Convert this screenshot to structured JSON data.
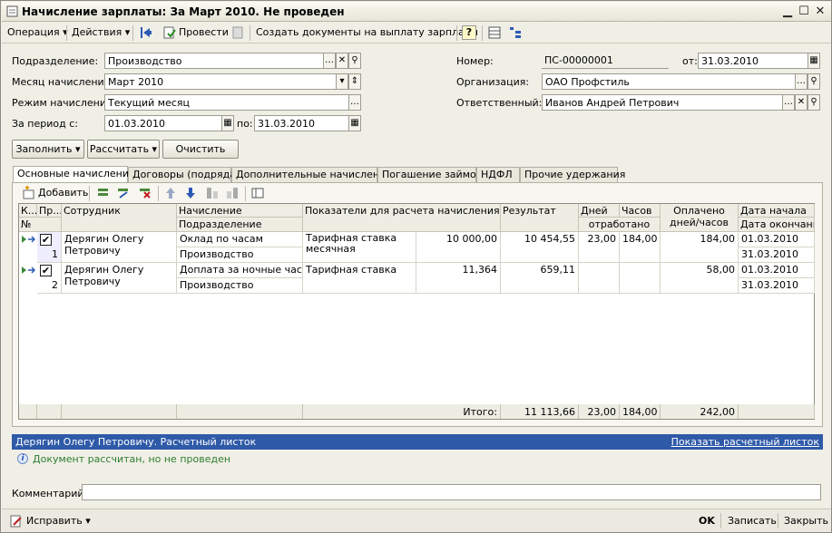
{
  "window": {
    "title": "Начисление зарплаты: За Март 2010. Не проведен"
  },
  "toolbar": {
    "operation": "Операция",
    "actions": "Действия",
    "post": "Провести",
    "create_docs": "Создать документы на выплату зарплаты"
  },
  "form": {
    "dept_label": "Подразделение:",
    "dept_value": "Производство",
    "month_label": "Месяц начисления:",
    "month_value": "Март 2010",
    "mode_label": "Режим начисления:",
    "mode_value": "Текущий месяц",
    "period_label": "За период с:",
    "period_from": "01.03.2010",
    "period_to_label": "по:",
    "period_to": "31.03.2010",
    "number_label": "Номер:",
    "number_value": "ПС-00000001",
    "date_label": "от:",
    "date_value": "31.03.2010",
    "org_label": "Организация:",
    "org_value": "ОАО Профстиль",
    "resp_label": "Ответственный:",
    "resp_value": "Иванов Андрей Петрович"
  },
  "actions": {
    "fill": "Заполнить",
    "calc": "Рассчитать",
    "clear": "Очистить"
  },
  "tabs": [
    "Основные начисления",
    "Договоры (подряда)",
    "Дополнительные начисления",
    "Погашение займов",
    "НДФЛ",
    "Прочие удержания"
  ],
  "grid_toolbar": {
    "add": "Добавить"
  },
  "grid": {
    "headers": {
      "k": "К...",
      "pr": "Пр...",
      "no": "№",
      "employee": "Сотрудник",
      "accrual": "Начисление",
      "subdivision": "Подразделение",
      "indicators": "Показатели для расчета начисления",
      "result": "Результат",
      "days": "Дней",
      "hours": "Часов",
      "worked": "отработано",
      "paid": "Оплачено",
      "paid2": "дней/часов",
      "date_start": "Дата начала",
      "date_end": "Дата окончания"
    },
    "rows": [
      {
        "no": "1",
        "checked": "✔",
        "employee": "Дерягин Олегу Петровичу",
        "accrual": "Оклад по часам",
        "subdivision": "Производство",
        "indicator": "Тарифная ставка месячная",
        "indicator_value": "10 000,00",
        "result": "10 454,55",
        "days": "23,00",
        "hours": "184,00",
        "paid": "184,00",
        "date_start": "01.03.2010",
        "date_end": "31.03.2010"
      },
      {
        "no": "2",
        "checked": "✔",
        "employee": "Дерягин Олегу Петровичу",
        "accrual": "Доплата за ночные часы",
        "subdivision": "Производство",
        "indicator": "Тарифная ставка",
        "indicator_value": "11,364",
        "result": "659,11",
        "days": "",
        "hours": "",
        "paid": "58,00",
        "date_start": "01.03.2010",
        "date_end": "31.03.2010"
      }
    ],
    "totals": {
      "label": "Итого:",
      "result": "11 113,66",
      "days": "23,00",
      "hours": "184,00",
      "paid": "242,00"
    }
  },
  "status": {
    "bar_text": "Дерягин Олегу Петровичу. Расчетный листок",
    "bar_link": "Показать расчетный листок",
    "info": "Документ рассчитан, но не проведен"
  },
  "comment": {
    "label": "Комментарий:",
    "value": ""
  },
  "bottom": {
    "edit": "Исправить",
    "ok": "OK",
    "save": "Записать",
    "close": "Закрыть"
  },
  "colors": {
    "accent": "#2e5aa8",
    "info_text": "#2f7d2f"
  }
}
